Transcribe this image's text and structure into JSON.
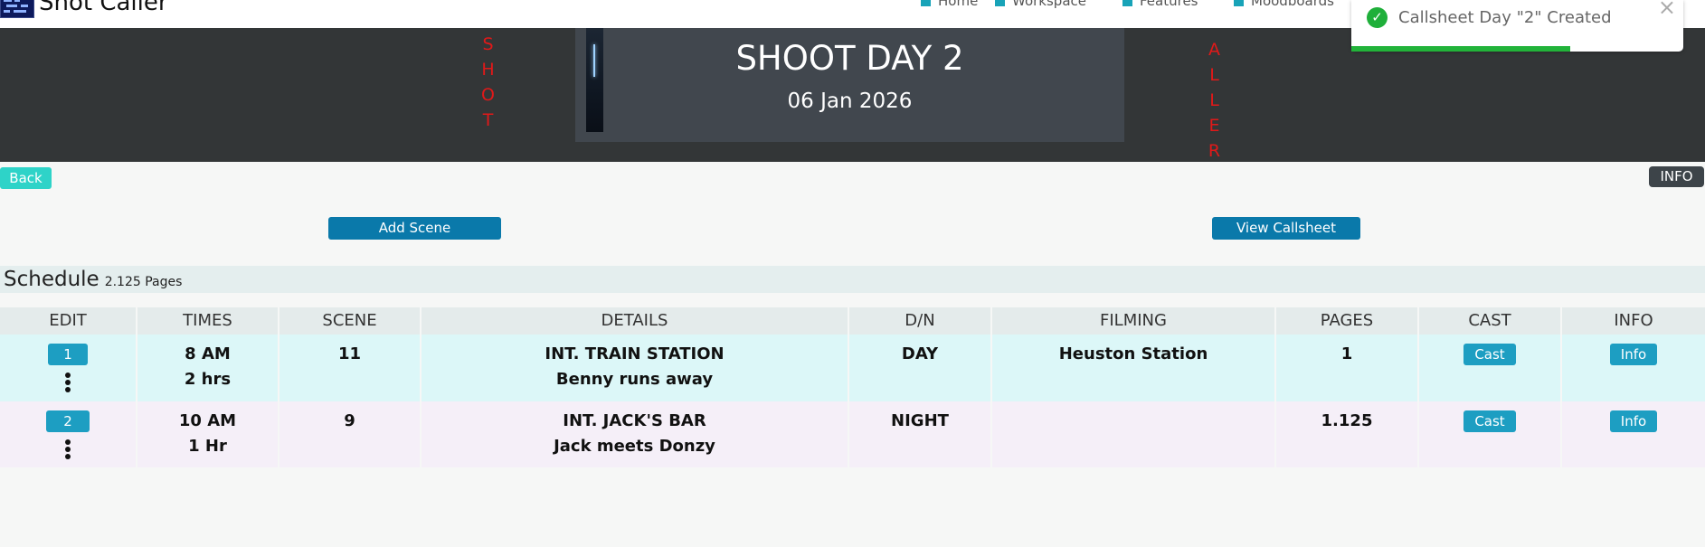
{
  "app": {
    "name": "Shot Caller"
  },
  "nav": {
    "items": [
      {
        "label": "Home",
        "icon": "home-icon"
      },
      {
        "label": "Workspace",
        "icon": "workspace-icon"
      },
      {
        "label": "Features",
        "icon": "features-icon"
      },
      {
        "label": "Moodboards",
        "icon": "moodboards-icon"
      }
    ]
  },
  "banner": {
    "left_word": "SHOT",
    "right_word": "ALLER",
    "title": "SHOOT DAY 2",
    "date": "06 Jan 2026"
  },
  "toast": {
    "message": "Callsheet Day \"2\" Created",
    "close": "×",
    "progress": 0.66,
    "color": "#22b33a"
  },
  "buttons": {
    "back": "Back",
    "info": "INFO",
    "add_scene": "Add Scene",
    "view_callsheet": "View Callsheet"
  },
  "schedule": {
    "title": "Schedule",
    "pages": "2.125 Pages"
  },
  "table": {
    "headers": [
      "EDIT",
      "TIMES",
      "SCENE",
      "DETAILS",
      "D/N",
      "FILMING",
      "PAGES",
      "CAST",
      "INFO"
    ],
    "rows": [
      {
        "edit": "1",
        "time": "8 AM",
        "duration": "2 hrs",
        "scene": "11",
        "location": "INT. TRAIN STATION",
        "description": "Benny runs away",
        "dn": "DAY",
        "filming": "Heuston Station",
        "pages": "1",
        "cast": "Cast",
        "info": "Info"
      },
      {
        "edit": "2",
        "time": "10 AM",
        "duration": "1 Hr",
        "scene": "9",
        "location": "INT. JACK'S BAR",
        "description": "Jack meets Donzy",
        "dn": "NIGHT",
        "filming": "",
        "pages": "1.125",
        "cast": "Cast",
        "info": "Info"
      }
    ]
  },
  "colors": {
    "banner": "#333637",
    "accent": "#1d9ec2",
    "back": "#2ed3c8",
    "row1": "#dcf7f8",
    "row2": "#f5eff8",
    "vertical_text": "#e01919"
  }
}
